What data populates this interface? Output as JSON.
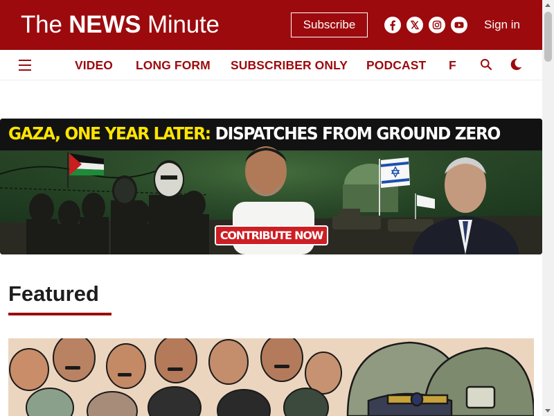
{
  "header": {
    "logo_light": "The ",
    "logo_bold": "NEWS",
    "logo_light2": " Minute",
    "subscribe_label": "Subscribe",
    "signin_label": "Sign in",
    "social_icons": [
      "facebook-icon",
      "x-twitter-icon",
      "instagram-icon",
      "youtube-icon"
    ],
    "brand_color": "#9c0a0d"
  },
  "nav": {
    "items": [
      {
        "label": "VIDEO"
      },
      {
        "label": "LONG FORM"
      },
      {
        "label": "SUBSCRIBER ONLY"
      },
      {
        "label": "PODCAST"
      },
      {
        "label": "F"
      }
    ],
    "icons": [
      "menu-icon",
      "search-icon",
      "dark-mode-moon-icon"
    ]
  },
  "banner": {
    "title_highlight": "GAZA, ONE YEAR LATER:",
    "title_rest": " DISPATCHES FROM GROUND ZERO",
    "cta_label": "CONTRIBUTE NOW",
    "highlight_color": "#ffe500",
    "cta_color": "#cc1f24"
  },
  "featured": {
    "heading": "Featured"
  }
}
